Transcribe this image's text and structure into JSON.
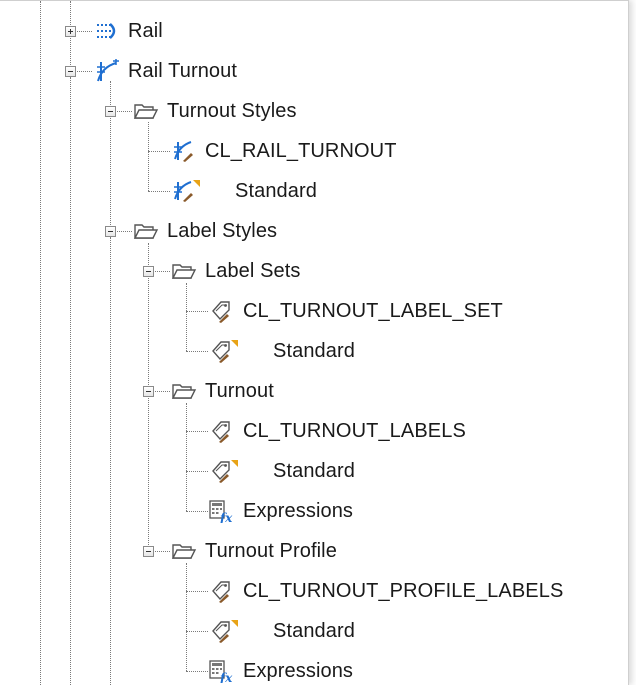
{
  "tree": {
    "rail": {
      "label": "Rail"
    },
    "rail_turnout": {
      "label": "Rail Turnout",
      "turnout_styles": {
        "label": "Turnout Styles",
        "items": [
          "CL_RAIL_TURNOUT",
          "Standard"
        ]
      },
      "label_styles": {
        "label": "Label Styles",
        "label_sets": {
          "label": "Label Sets",
          "items": [
            "CL_TURNOUT_LABEL_SET",
            "Standard"
          ]
        },
        "turnout": {
          "label": "Turnout",
          "items": [
            "CL_TURNOUT_LABELS",
            "Standard",
            "Expressions"
          ]
        },
        "turnout_profile": {
          "label": "Turnout Profile",
          "items": [
            "CL_TURNOUT_PROFILE_LABELS",
            "Standard",
            "Expressions"
          ]
        }
      }
    }
  },
  "colors": {
    "accent_blue": "#1f6fd1",
    "default_flag": "#e8a317",
    "connector": "#7a7a7a"
  },
  "icons": [
    "rail-icon",
    "turnout-icon",
    "folder-icon",
    "label-style-icon",
    "expressions-icon",
    "default-flag-icon"
  ]
}
